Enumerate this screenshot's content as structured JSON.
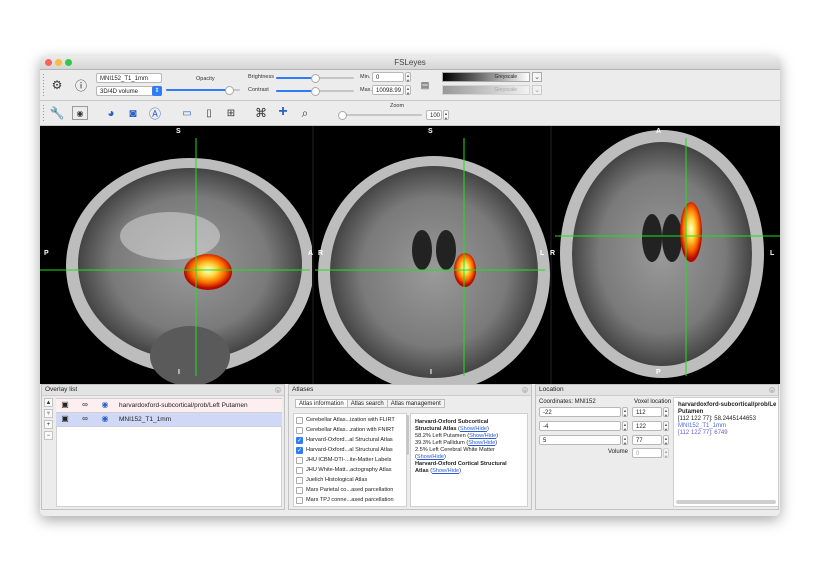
{
  "window": {
    "title": "FSLeyes"
  },
  "toolbar1": {
    "overlay_name": "MNI152_T1_1mm",
    "display_type": "3D/4D volume",
    "opacity_label": "Opacity",
    "brightness_label": "Brightness",
    "contrast_label": "Contrast",
    "min_label": "Min.",
    "max_label": "Max.",
    "min_value": "0",
    "max_value": "10098.99",
    "colormap1": "Greyscale",
    "colormap2": "Greyscale",
    "opacity": 0.85,
    "brightness": 0.5,
    "contrast": 0.5
  },
  "toolbar2": {
    "zoom_label": "Zoom",
    "zoom_value": "100",
    "zoom": 0.0
  },
  "viewer": {
    "sagittal": {
      "top": "S",
      "bottom": "I",
      "left": "P",
      "right": "A"
    },
    "coronal": {
      "top": "S",
      "bottom": "I",
      "left": "R",
      "right": "L"
    },
    "axial": {
      "top": "A",
      "bottom": "P",
      "left": "R",
      "right": "L"
    },
    "crosshair_color": "#1fe01f"
  },
  "overlay_list": {
    "title": "Overlay list",
    "items": [
      {
        "name": "harvardoxford-subcortical/prob/Left Putamen"
      },
      {
        "name": "MNI152_T1_1mm"
      }
    ],
    "side_buttons": [
      "▲",
      "▼",
      "+",
      "−"
    ]
  },
  "atlases": {
    "title": "Atlases",
    "tabs": [
      "Atlas information",
      "Atlas search",
      "Atlas management"
    ],
    "list": [
      {
        "label": "Cerebellar Atlas...ization with FLIRT",
        "checked": false
      },
      {
        "label": "Cerebellar Atlas...zation with FNIRT",
        "checked": false
      },
      {
        "label": "Harvard-Oxford...al Structural Atlas",
        "checked": true
      },
      {
        "label": "Harvard-Oxford...al Structural Atlas",
        "checked": true
      },
      {
        "label": "JHU ICBM-DTI-...ite-Matter Labels",
        "checked": false
      },
      {
        "label": "JHU White-Matt...actography Atlas",
        "checked": false
      },
      {
        "label": "Juelich Histological Atlas",
        "checked": false
      },
      {
        "label": "Mars Parietal co...ased parcellation",
        "checked": false
      },
      {
        "label": "Mars TPJ conne...ased parcellation",
        "checked": false
      }
    ],
    "info": {
      "sub_title_1": "Harvard-Oxford Subcortical",
      "sub_title_2": "Structural Atlas",
      "show_hide": "Show/Hide",
      "entries": [
        "58.2% Left Putamen",
        "39.3% Left Pallidum",
        "2.5% Left Cerebral White Matter"
      ],
      "cort_title_1": "Harvard-Oxford Cortical Structural",
      "cort_title_2": "Atlas"
    }
  },
  "location": {
    "title": "Location",
    "coords_label": "Coordinates: MNI152",
    "voxel_label": "Voxel location",
    "world": [
      "-22",
      "-4",
      "5"
    ],
    "voxel": [
      "112",
      "122",
      "77"
    ],
    "volume_label": "Volume",
    "volume_value": "0",
    "info": {
      "line1": "harvardoxford-subcortical/prob/Le",
      "line2": "Putamen",
      "line3": "[112 122 77]: 58.2445144653",
      "line4": "MNI152_T1_1mm",
      "line5": "[112 122 77]: 6749"
    }
  }
}
